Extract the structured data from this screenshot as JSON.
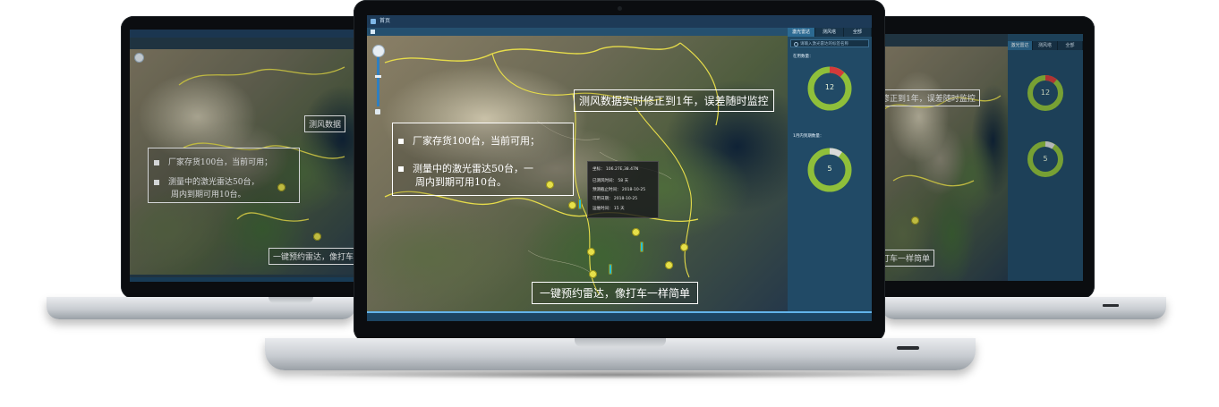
{
  "app": {
    "title": "首页"
  },
  "panel": {
    "tabs": [
      "激光雷达",
      "测风塔",
      "全部"
    ],
    "active_tab": 0,
    "search_placeholder": "请输入激光雷达的标签名称",
    "section1_label": "在用数量：",
    "section2_label": "1月内到期数量：",
    "donut1": {
      "value": "12",
      "fill_fraction": 0.9,
      "ring_color": "#8fbf3a",
      "accent_color": "#d43a3a"
    },
    "donut2": {
      "value": "5",
      "fill_fraction": 0.93,
      "ring_color": "#8fbf3a",
      "accent_color": "#d9d9d9"
    }
  },
  "map": {
    "callout_top": "测风数据实时修正到1年，误差随时监控",
    "bullets": [
      "厂家存货100台，当前可用；",
      "测量中的激光雷达50台，一"
    ],
    "bullet_continuation": "周内到期可用10台。",
    "callout_bottom": "一键预约雷达，像打车一样简单",
    "info": {
      "coords": "坐标： 106.27E,38.47N",
      "used_days": "已测风时间：    58 天",
      "deadline": "预测截止时间：   2018-10-25",
      "available_date": "可用日期：      2018-10-25",
      "remaining": "运维时间：      15 天"
    }
  },
  "left_screen": {
    "callout_top": "测风数据",
    "bullets": [
      "厂家存货100台，当前可用；",
      "测量中的激光雷达50台，"
    ],
    "bullet_continuation": "周内到期可用10台。",
    "callout_bottom": "一键预约雷达，像打车"
  },
  "right_screen": {
    "callout_top": "修正到1年，误差随时监控",
    "callout_bottom": "打车一样简单",
    "tabs": [
      "激光雷达",
      "测风塔",
      "全部"
    ],
    "donut1": {
      "value": "12"
    },
    "donut2": {
      "value": "5"
    }
  }
}
